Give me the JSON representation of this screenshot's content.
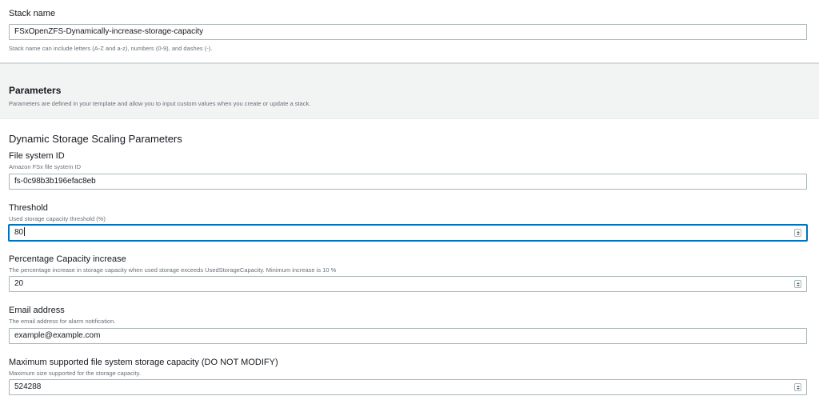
{
  "stack": {
    "label": "Stack name",
    "value": "FSxOpenZFS-Dynamically-increase-storage-capacity",
    "hint": "Stack name can include letters (A-Z and a-z), numbers (0-9), and dashes (-)."
  },
  "parameters": {
    "title": "Parameters",
    "description": "Parameters are defined in your template and allow you to input custom values when you create or update a stack."
  },
  "group": {
    "title": "Dynamic Storage Scaling Parameters"
  },
  "fields": [
    {
      "label": "File system ID",
      "description": "Amazon FSx file system ID",
      "value": "fs-0c98b3b196efac8eb"
    },
    {
      "label": "Threshold",
      "description": "Used storage capacity threshold (%)",
      "value": "80"
    },
    {
      "label": "Percentage Capacity increase",
      "description": "The percentage increase in storage capacity when used storage exceeds UsedStorageCapacity. Minimum increase is 10 %",
      "value": "20"
    },
    {
      "label": "Email address",
      "description": "The email address for alarm notification.",
      "value": "example@example.com"
    },
    {
      "label": "Maximum supported file system storage capacity (DO NOT MODIFY)",
      "description": "Maximum size supported for the storage capacity.",
      "value": "524288"
    }
  ],
  "colors": {
    "focus_border": "#0073bb",
    "header_bg": "#f2f3f3",
    "input_border": "#aab7b8"
  },
  "icons": {
    "number_spinner": "up-down-spinner-icon"
  }
}
